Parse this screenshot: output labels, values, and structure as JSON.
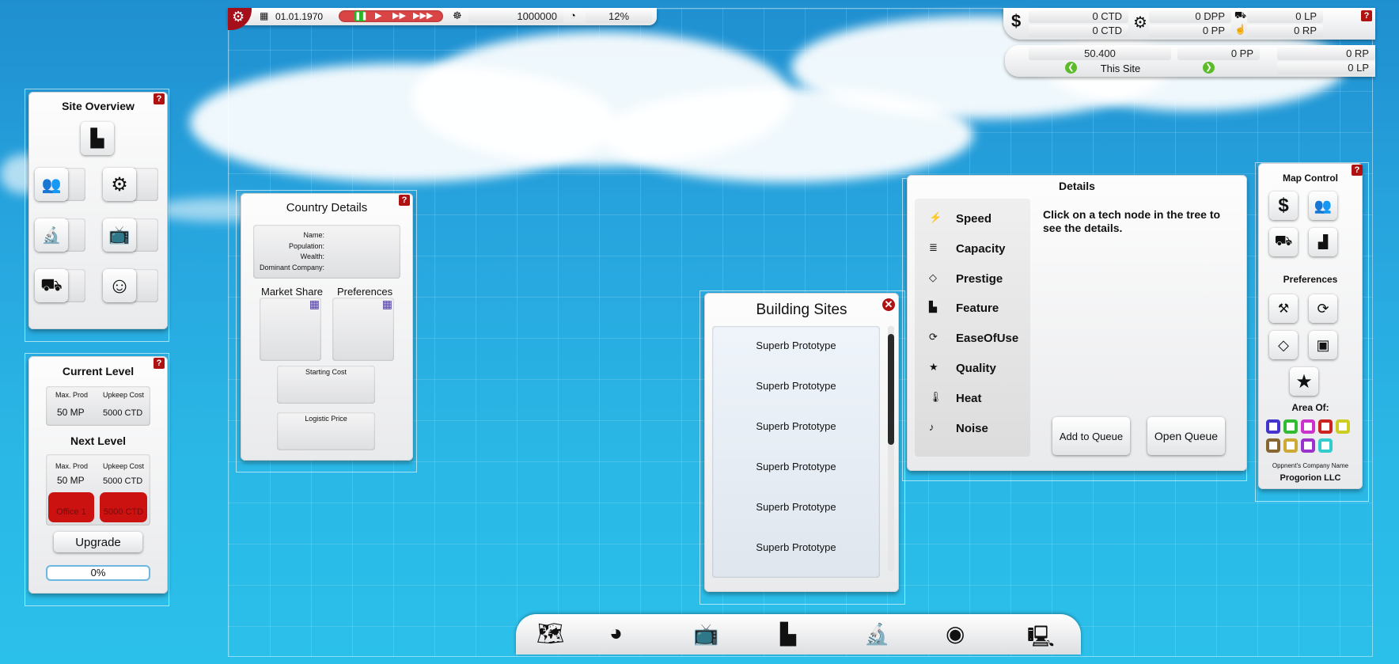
{
  "topbar": {
    "date": "01.01.1970",
    "money": "1000000",
    "percent": "12%"
  },
  "resources": {
    "ctd1": "0 CTD",
    "ctd2": "0 CTD",
    "dpp": "0 DPP",
    "pp1": "0 PP",
    "lp1": "0 LP",
    "rp1": "0 RP",
    "mp_value": "50.400",
    "pp2": "0 PP",
    "rp2": "0 RP",
    "lp2": "0 LP",
    "site_label": "This Site"
  },
  "site_overview": {
    "title": "Site Overview"
  },
  "current_level": {
    "title": "Current Level",
    "max_prod_label": "Max. Prod",
    "upkeep_label": "Upkeep Cost",
    "max_prod": "50 MP",
    "upkeep": "5000 CTD",
    "next_title": "Next Level",
    "next_max_prod": "50 MP",
    "next_upkeep": "5000 CTD",
    "office_label": "Office 1",
    "office_cost": "5000 CTD",
    "upgrade": "Upgrade",
    "progress": "0%"
  },
  "country": {
    "title": "Country Details",
    "name_label": "Name:",
    "population_label": "Population:",
    "wealth_label": "Wealth:",
    "dominant_label": "Dominant Company:",
    "market_share": "Market Share",
    "preferences": "Preferences",
    "starting_cost": "Starting Cost",
    "logistic_price": "Logistic Price"
  },
  "building_sites": {
    "title": "Building Sites",
    "items": [
      "Superb Prototype",
      "Superb Prototype",
      "Superb Prototype",
      "Superb Prototype",
      "Superb Prototype",
      "Superb Prototype"
    ]
  },
  "details": {
    "title": "Details",
    "categories": [
      "Speed",
      "Capacity",
      "Prestige",
      "Feature",
      "EaseOfUse",
      "Quality",
      "Heat",
      "Noise"
    ],
    "message": "Click on a tech node in the tree to see the details.",
    "add_queue": "Add to Queue",
    "open_queue": "Open Queue"
  },
  "map_control": {
    "title": "Map Control",
    "preferences": "Preferences",
    "area_of": "Area Of:",
    "opponent_label": "Oppnent's Company Name",
    "opponent": "Progorion LLC",
    "swatches": [
      "#4433cc",
      "#33bb33",
      "#cc33cc",
      "#cc2222",
      "#cccc22",
      "#886633",
      "#ccaa33",
      "#9933cc",
      "#33cccc"
    ]
  },
  "colors": {
    "accent_red": "#b01111",
    "speed_green": "#2bb52b",
    "progress_red": "#d94545"
  }
}
